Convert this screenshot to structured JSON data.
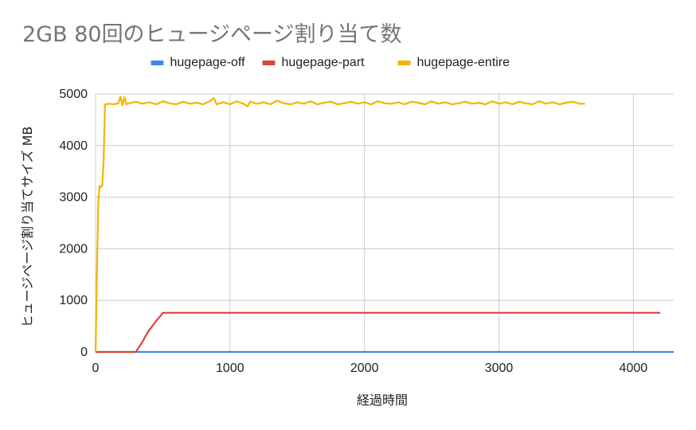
{
  "chart_data": {
    "type": "line",
    "title": "2GB 80回のヒュージページ割り当て数",
    "xlabel": "経過時間",
    "ylabel": "ヒュージページ割り当てサイズ MB",
    "xlim": [
      0,
      4300
    ],
    "ylim": [
      0,
      5000
    ],
    "x_ticks": [
      0,
      1000,
      2000,
      3000,
      4000
    ],
    "y_ticks": [
      0,
      1000,
      2000,
      3000,
      4000,
      5000
    ],
    "x_tick_labels": [
      "0",
      "1000",
      "2000",
      "3000",
      "4000"
    ],
    "y_tick_labels": [
      "0",
      "1000",
      "2000",
      "3000",
      "4000",
      "5000"
    ],
    "legend_position": "top",
    "grid": true,
    "series": [
      {
        "name": "hugepage-off",
        "color": "#4285f4",
        "x": [
          0,
          4300
        ],
        "y": [
          0,
          0
        ]
      },
      {
        "name": "hugepage-part",
        "color": "#db4437",
        "x": [
          0,
          300,
          310,
          330,
          350,
          370,
          390,
          410,
          430,
          450,
          470,
          490,
          500,
          520,
          4200
        ],
        "y": [
          0,
          0,
          40,
          120,
          200,
          300,
          390,
          460,
          530,
          600,
          660,
          720,
          760,
          760,
          760
        ]
      },
      {
        "name": "hugepage-entire",
        "color": "#f4b400",
        "x": [
          0,
          10,
          20,
          30,
          40,
          50,
          60,
          70,
          80,
          100,
          140,
          170,
          185,
          200,
          215,
          230,
          250,
          300,
          350,
          400,
          450,
          500,
          550,
          600,
          650,
          700,
          750,
          800,
          850,
          880,
          900,
          950,
          1000,
          1050,
          1100,
          1130,
          1150,
          1200,
          1250,
          1300,
          1350,
          1400,
          1450,
          1500,
          1550,
          1600,
          1650,
          1700,
          1750,
          1800,
          1850,
          1900,
          1950,
          2000,
          2050,
          2100,
          2150,
          2200,
          2250,
          2300,
          2350,
          2400,
          2450,
          2500,
          2550,
          2600,
          2650,
          2700,
          2750,
          2800,
          2850,
          2900,
          2950,
          3000,
          3050,
          3100,
          3150,
          3200,
          3250,
          3300,
          3350,
          3400,
          3450,
          3500,
          3550,
          3600,
          3640
        ],
        "y": [
          0,
          1500,
          2900,
          3220,
          3200,
          3220,
          3700,
          4800,
          4800,
          4810,
          4800,
          4820,
          4950,
          4780,
          4940,
          4800,
          4820,
          4850,
          4810,
          4840,
          4800,
          4860,
          4820,
          4800,
          4850,
          4810,
          4830,
          4800,
          4860,
          4920,
          4800,
          4840,
          4800,
          4860,
          4810,
          4760,
          4850,
          4810,
          4840,
          4800,
          4870,
          4820,
          4800,
          4840,
          4810,
          4860,
          4800,
          4830,
          4850,
          4800,
          4820,
          4850,
          4810,
          4840,
          4800,
          4860,
          4820,
          4810,
          4840,
          4800,
          4850,
          4830,
          4800,
          4860,
          4810,
          4840,
          4800,
          4820,
          4850,
          4810,
          4830,
          4800,
          4860,
          4810,
          4840,
          4800,
          4850,
          4820,
          4800,
          4860,
          4810,
          4840,
          4800,
          4830,
          4850,
          4810,
          4810
        ]
      }
    ]
  }
}
